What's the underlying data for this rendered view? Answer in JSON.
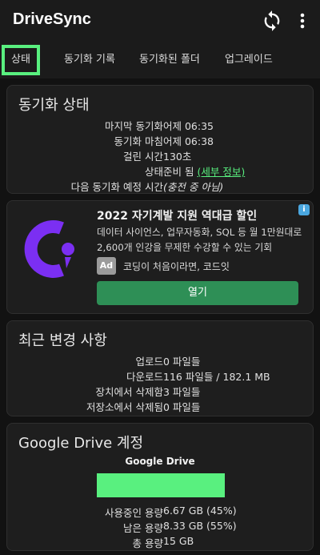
{
  "app": {
    "title": "DriveSync"
  },
  "tabs": [
    {
      "label": "상태"
    },
    {
      "label": "동기화 기록"
    },
    {
      "label": "동기화된 폴더"
    },
    {
      "label": "업그레이드"
    }
  ],
  "sync_status": {
    "title": "동기화 상태",
    "rows": [
      {
        "label": "마지막 동기화",
        "value": "어제 06:35"
      },
      {
        "label": "동기화 마침",
        "value": "어제 06:38"
      },
      {
        "label": "걸린 시간",
        "value": "130초"
      },
      {
        "label": "상태",
        "value": "준비 됨",
        "link": "(세부 정보)"
      },
      {
        "label": "다음 동기화 예정 시간",
        "value": "(충전 중 아님)"
      }
    ]
  },
  "ad": {
    "title": "2022 자기계발 지원 역대급 할인",
    "description": "데이터 사이언스, 업무자동화, SQL 등 월 1만원대로 2,600개 인강을 무제한 수강할 수 있는 기회",
    "badge": "Ad",
    "subtitle": "코딩이 처음이라면, 코드잇",
    "button": "열기",
    "info_icon": "i",
    "logo_color": "#7b2ff2"
  },
  "recent_changes": {
    "title": "최근 변경 사항",
    "rows": [
      {
        "label": "업로드",
        "value": "0 파일들"
      },
      {
        "label": "다운로드",
        "value": "116 파일들 / 182.1 MB"
      },
      {
        "label": "장치에서 삭제함",
        "value": "3 파일들"
      },
      {
        "label": "저장소에서 삭제됨",
        "value": "0 파일들"
      }
    ]
  },
  "drive_account": {
    "title": "Google Drive 계정",
    "service": "Google Drive",
    "rows": [
      {
        "label": "사용중인 용량",
        "value": "6.67 GB (45%)"
      },
      {
        "label": "남은 용량",
        "value": "8.33 GB (55%)"
      },
      {
        "label": "총 용량",
        "value": "15 GB"
      }
    ]
  },
  "colors": {
    "accent": "#59f07f",
    "background": "#121212",
    "card": "#1e1e1e",
    "button": "#2e8f56"
  }
}
